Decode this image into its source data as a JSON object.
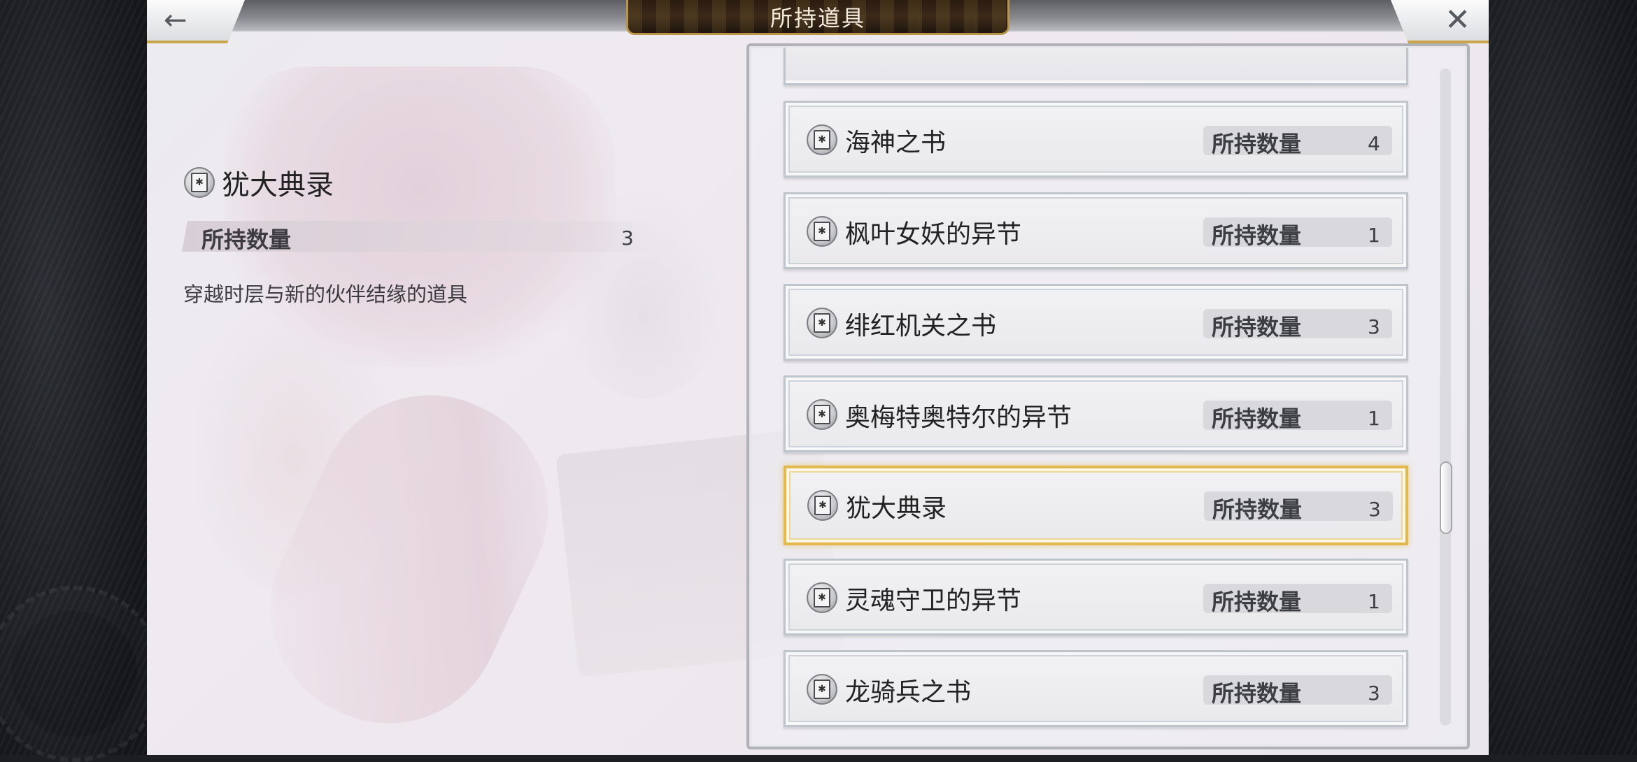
{
  "header": {
    "title": "所持道具",
    "back_icon": "←",
    "close_icon": "✕"
  },
  "detail": {
    "name": "犹大典录",
    "qty_label": "所持数量",
    "qty_value": "3",
    "description": "穿越时层与新的伙伴结缘的道具"
  },
  "items": [
    {
      "name": "海神之书",
      "qty_label": "所持数量",
      "qty": "4"
    },
    {
      "name": "枫叶女妖的异节",
      "qty_label": "所持数量",
      "qty": "1"
    },
    {
      "name": "绯红机关之书",
      "qty_label": "所持数量",
      "qty": "3"
    },
    {
      "name": "奥梅特奥特尔的异节",
      "qty_label": "所持数量",
      "qty": "1"
    },
    {
      "name": "犹大典录",
      "qty_label": "所持数量",
      "qty": "3"
    },
    {
      "name": "灵魂守卫的异节",
      "qty_label": "所持数量",
      "qty": "1"
    },
    {
      "name": "龙骑兵之书",
      "qty_label": "所持数量",
      "qty": "3"
    }
  ],
  "colors": {
    "selected_border": "#e2b84d",
    "title_plate": "#2a1b10",
    "accent_gold": "#c9a64a"
  }
}
